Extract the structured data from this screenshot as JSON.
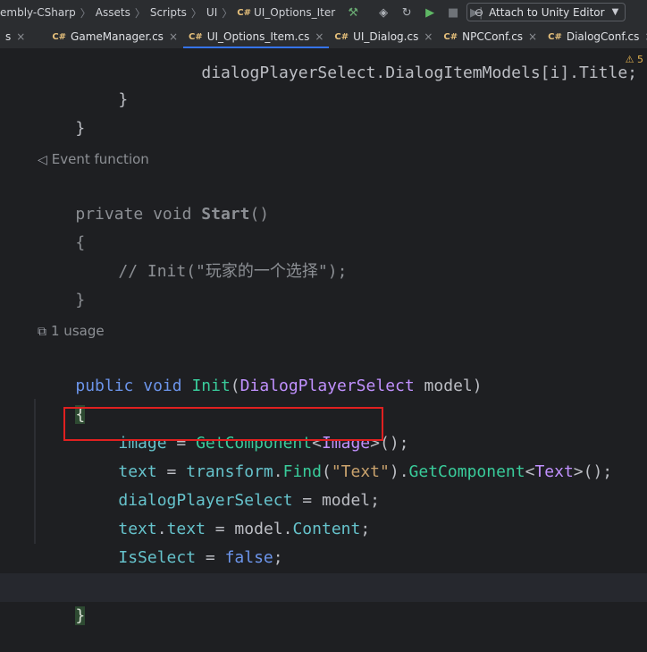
{
  "breadcrumb": {
    "items": [
      "embly-CSharp",
      "Assets",
      "Scripts",
      "UI",
      "UI_Options_Iter"
    ],
    "lang_badge": "C#"
  },
  "toolbar": {
    "attach_label": "Attach to Unity Editor"
  },
  "tabs": [
    {
      "lang": "",
      "label": "s",
      "close": "×",
      "active": false
    },
    {
      "lang": "C#",
      "label": "GameManager.cs",
      "close": "×",
      "active": false
    },
    {
      "lang": "C#",
      "label": "UI_Options_Item.cs",
      "close": "×",
      "active": true
    },
    {
      "lang": "C#",
      "label": "UI_Dialog.cs",
      "close": "×",
      "active": false
    },
    {
      "lang": "C#",
      "label": "NPCConf.cs",
      "close": "×",
      "active": false
    },
    {
      "lang": "C#",
      "label": "DialogConf.cs",
      "close": "×",
      "active": false
    }
  ],
  "editor": {
    "warning_count": "5",
    "hint_event": "Event function",
    "hint_usage": "1 usage",
    "code": {
      "l_close_inner": "}",
      "l_close_outer": "}",
      "start_kw1": "private",
      "start_kw2": "void",
      "start_name": "Start",
      "start_parens": "()",
      "start_open": "{",
      "start_comment": "// Init(\"玩家的一个选择\");",
      "start_close": "}",
      "init_kw1": "public",
      "init_kw2": "void",
      "init_name": "Init",
      "init_paren_open": "(",
      "init_type": "DialogPlayerSelect",
      "init_param": " model)",
      "init_open": "{",
      "a1_field": "image",
      "a1_eq": " = ",
      "a1_method": "GetComponent",
      "a1_lt": "<",
      "a1_type": "Image",
      "a1_end": ">();",
      "a2_field": "text",
      "a2_eq": " = ",
      "a2_obj": "transform",
      "a2_dot1": ".",
      "a2_find": "Find",
      "a2_p1": "(",
      "a2_str": "\"Text\"",
      "a2_p2": ").",
      "a2_method": "GetComponent",
      "a2_lt": "<",
      "a2_type": "Text",
      "a2_end": ">();",
      "a3_field": "dialogPlayerSelect",
      "a3_rest": " = model;",
      "a4_field": "text",
      "a4_dot": ".",
      "a4_prop": "text",
      "a4_eq": " = model.",
      "a4_content": "Content",
      "a4_end": ";",
      "a5_field": "IsSelect",
      "a5_eq": " = ",
      "a5_val": "false",
      "a5_end": ";",
      "init_close": "}"
    }
  }
}
